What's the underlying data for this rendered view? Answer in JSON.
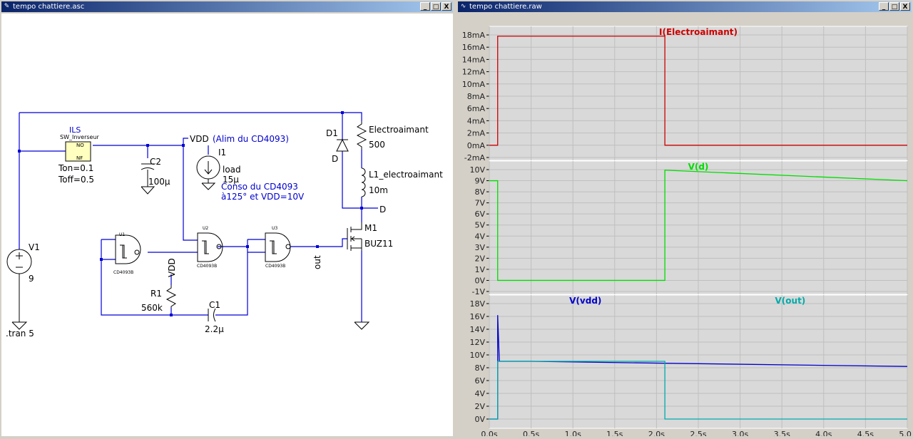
{
  "schematic_window": {
    "title": "tempo chattiere.asc",
    "buttons": {
      "minimize": "_",
      "restore": "□",
      "close": "X"
    },
    "labels": {
      "ils": "ILS",
      "sw_inverseur": "SW_Inverseur",
      "no": "NO",
      "nf": "NF",
      "ton": "Ton=0.1",
      "toff": "Toff=0.5",
      "c2": "C2",
      "c2_value": "100µ",
      "vdd_net": "VDD",
      "vdd_comment": "(Alim du CD4093)",
      "i1": "I1",
      "i1_load": "load",
      "i1_value": "15µ",
      "conso_line1": "Conso du CD4093",
      "conso_line2": "à125° et VDD=10V",
      "d1": "D1",
      "d1_net": "D",
      "electroaimant": "Electroaimant",
      "electroaimant_value": "500",
      "l1": "L1_electroaimant",
      "l1_value": "10m",
      "d_net": "D",
      "m1": "M1",
      "m1_model": "BUZ11",
      "out_net": "out",
      "v1": "V1",
      "v1_value": "9",
      "tran": ".tran 5",
      "u1": "U1",
      "u2": "U2",
      "u3": "U3",
      "u1_model": "CD4093B",
      "u2_model": "CD4093B",
      "u3_model": "CD4093B",
      "r1_vdd": "VDD",
      "r1": "R1",
      "r1_value": "560k",
      "c1": "C1",
      "c1_value": "2.2µ"
    }
  },
  "waveform_window": {
    "title": "tempo chattiere.raw",
    "buttons": {
      "minimize": "_",
      "restore": "□",
      "close": "X"
    }
  },
  "colors": {
    "wire": "#0000d8",
    "component": "#000000",
    "i_electro": "#cc0000",
    "v_d": "#00dd00",
    "v_vdd": "#0000cc",
    "v_out": "#00aaaa",
    "plot_bg": "#d9d9d9"
  },
  "chart_data": [
    {
      "type": "line",
      "series": [
        {
          "name": "I(Electroaimant)",
          "x": [
            0,
            0.1,
            0.1,
            2.1,
            2.1,
            5.0
          ],
          "y": [
            0,
            0,
            17.8,
            17.8,
            0,
            0
          ]
        }
      ],
      "ylim": [
        -2,
        18
      ],
      "yticks": [
        "-2mA",
        "0mA",
        "2mA",
        "4mA",
        "6mA",
        "8mA",
        "10mA",
        "12mA",
        "14mA",
        "16mA",
        "18mA"
      ],
      "xlim": [
        0,
        5
      ],
      "grid": true
    },
    {
      "type": "line",
      "series": [
        {
          "name": "V(d)",
          "x": [
            0,
            0.1,
            0.1,
            2.1,
            2.1,
            5.0
          ],
          "y": [
            9,
            9,
            0,
            0,
            9.95,
            9
          ]
        }
      ],
      "ylim": [
        -1,
        10
      ],
      "yticks": [
        "-1V",
        "0V",
        "1V",
        "2V",
        "3V",
        "4V",
        "5V",
        "6V",
        "7V",
        "8V",
        "9V",
        "10V"
      ],
      "xlim": [
        0,
        5
      ],
      "grid": true
    },
    {
      "type": "line",
      "series": [
        {
          "name": "V(vdd)",
          "x": [
            0,
            0.1,
            0.1,
            0.12,
            0.5,
            2.1,
            5.0
          ],
          "y": [
            0,
            0,
            16.2,
            9.0,
            9.0,
            8.7,
            8.2
          ]
        },
        {
          "name": "V(out)",
          "x": [
            0,
            0.1,
            0.1,
            2.1,
            2.1,
            5.0
          ],
          "y": [
            0,
            0,
            9.0,
            9.0,
            0,
            0
          ]
        }
      ],
      "ylim": [
        -1,
        18
      ],
      "yticks": [
        "0V",
        "2V",
        "4V",
        "6V",
        "8V",
        "10V",
        "12V",
        "14V",
        "16V",
        "18V"
      ],
      "xlim": [
        0,
        5
      ],
      "xticks": [
        "0.0s",
        "0.5s",
        "1.0s",
        "1.5s",
        "2.0s",
        "2.5s",
        "3.0s",
        "3.5s",
        "4.0s",
        "4.5s",
        "5.0s"
      ],
      "grid": true
    }
  ]
}
